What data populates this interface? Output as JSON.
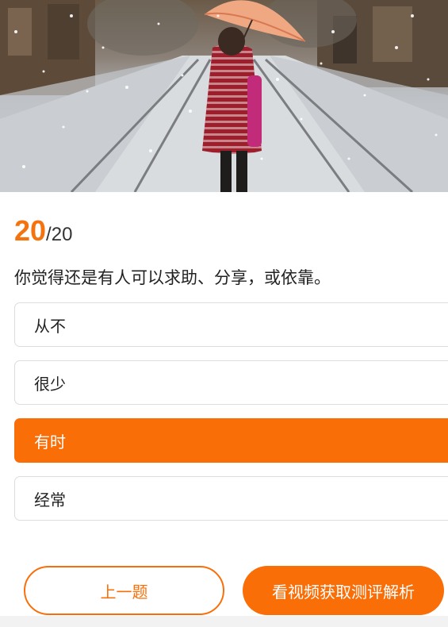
{
  "question": {
    "current": "20",
    "separator": "/",
    "total": "20",
    "text": "你觉得还是有人可以求助、分享，或依靠。"
  },
  "options": [
    {
      "label": "从不",
      "selected": false
    },
    {
      "label": "很少",
      "selected": false
    },
    {
      "label": "有时",
      "selected": true
    },
    {
      "label": "经常",
      "selected": false
    }
  ],
  "buttons": {
    "prev_label": "上一题",
    "video_label": "看视频获取测评解析"
  },
  "colors": {
    "accent": "#fa6e08",
    "current_number": "#f5730f"
  }
}
